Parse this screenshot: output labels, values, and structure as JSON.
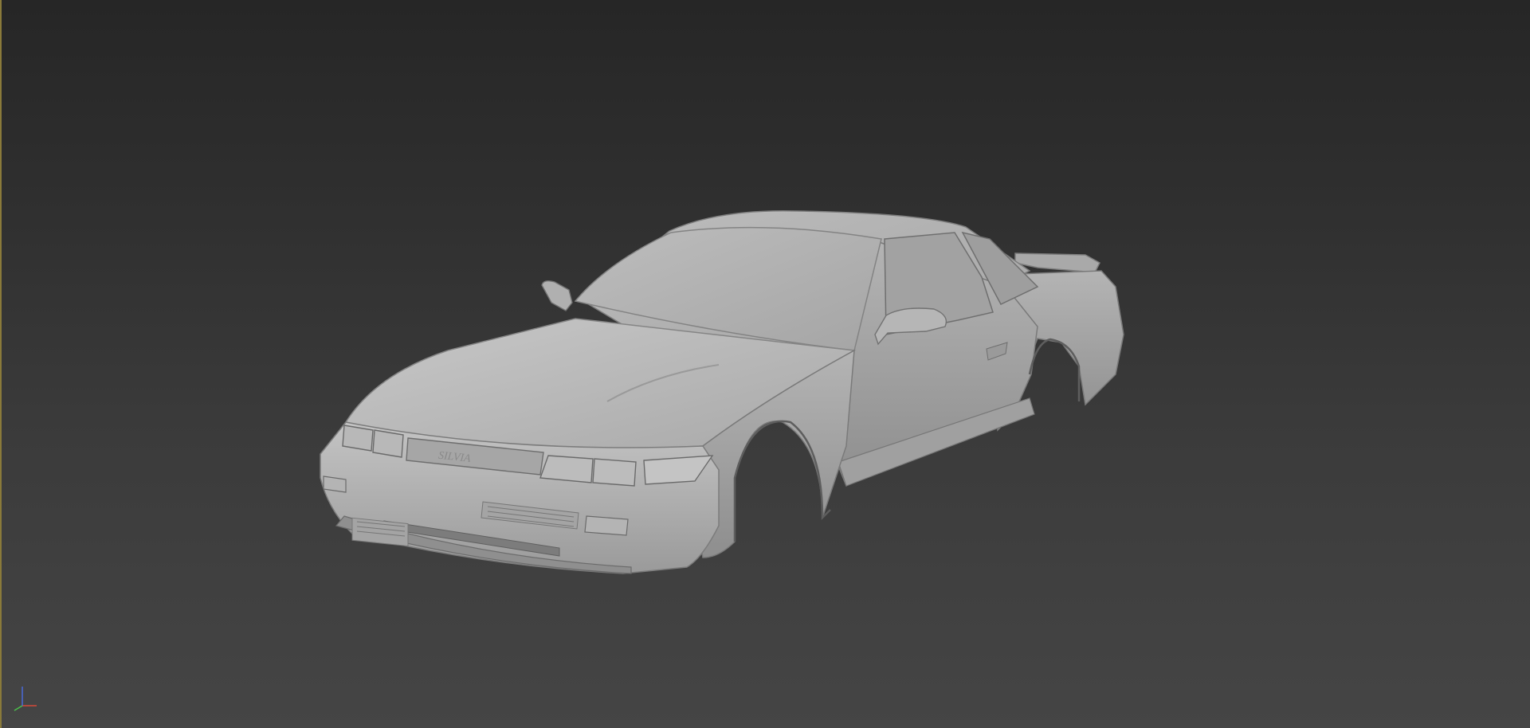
{
  "viewport": {
    "background_top": "#262626",
    "background_bottom": "#454545",
    "active_border_color": "#8a7a3a",
    "shading": "default-shaded-clay"
  },
  "model": {
    "emblem_text": "SILVIA",
    "body_color": "#b9b9b9",
    "highlight_color": "#d2d2d2",
    "shadow_color": "#8c8c8c"
  },
  "gizmo": {
    "x_axis_color": "#d44a3a",
    "y_axis_color": "#4ac04a",
    "z_axis_color": "#4a6ad8"
  }
}
